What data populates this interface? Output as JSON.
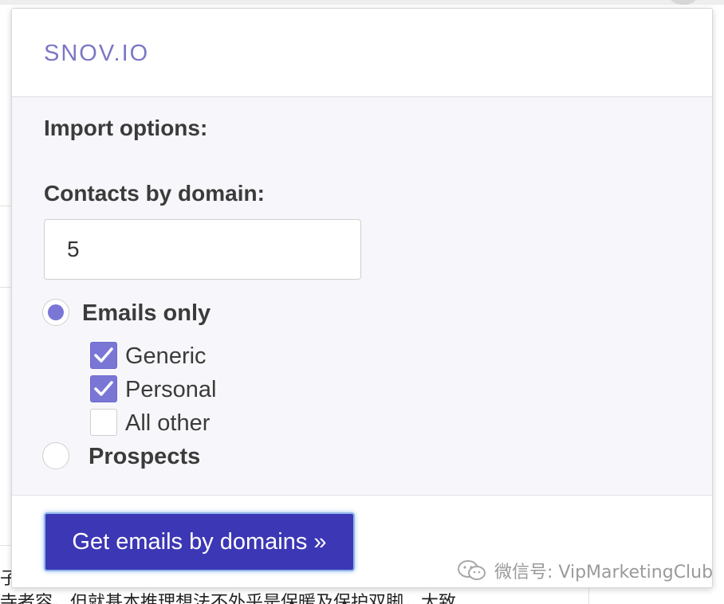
{
  "popup": {
    "brand": "SNOV.IO",
    "section_title": "Import options:",
    "contacts_label": "Contacts by domain:",
    "contacts_value": "5",
    "options": {
      "emails_only": {
        "label": "Emails only",
        "selected": true
      },
      "prospects": {
        "label": "Prospects",
        "selected": false
      }
    },
    "email_types": [
      {
        "label": "Generic",
        "checked": true
      },
      {
        "label": "Personal",
        "checked": true
      },
      {
        "label": "All other",
        "checked": false
      }
    ],
    "submit_label": "Get emails by domains »"
  },
  "background": {
    "line1": "子",
    "line2": "寺者容，但就基本推理想法不外乎是保暖及保护双脚，大致"
  },
  "watermark": {
    "text": "微信号: VipMarketingClub",
    "icon": "wechat-icon"
  },
  "colors": {
    "brand": "#7b77c4",
    "accent": "#7a76d6",
    "button": "#3c37b5"
  }
}
